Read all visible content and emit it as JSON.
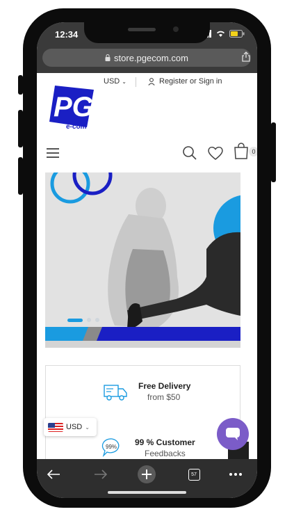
{
  "status_bar": {
    "time": "12:34"
  },
  "browser": {
    "url": "store.pgecom.com",
    "tabs_count": "57"
  },
  "header": {
    "currency": "USD",
    "register_label": "Register or Sign in",
    "cart_count": "0"
  },
  "logo": {
    "letters": "PG",
    "tagline": "e-com"
  },
  "hero": {
    "active_slide": 1,
    "slide_count": 3
  },
  "features": [
    {
      "title": "Free Delivery",
      "subtitle": "from $50",
      "icon": "delivery-truck-icon"
    },
    {
      "title": "99 % Customer",
      "subtitle": "Feedbacks",
      "icon": "feedback-bubble-icon",
      "icon_label": "99%"
    }
  ],
  "currency_switcher": {
    "label": "USD"
  },
  "colors": {
    "brand_blue": "#1a1fc4",
    "accent_cyan": "#1a9be0",
    "chat_purple": "#7b5cc8"
  }
}
